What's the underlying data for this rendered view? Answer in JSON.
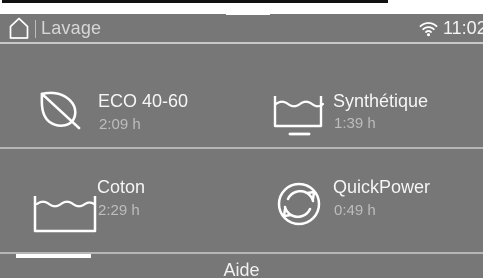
{
  "status_bar": {
    "title": "Lavage",
    "time": "11:02",
    "home_icon": "home-icon",
    "wifi_icon": "wifi-icon"
  },
  "programs": [
    {
      "name": "ECO 40-60",
      "duration": "2:09 h",
      "icon": "leaf-icon"
    },
    {
      "name": "Synthétique",
      "duration": "1:39 h",
      "icon": "synthetic-wash-tub-icon"
    },
    {
      "name": "Coton",
      "duration": "2:29 h",
      "icon": "cotton-wash-tub-icon"
    },
    {
      "name": "QuickPower",
      "duration": "0:49 h",
      "icon": "quickpower-cycle-icon"
    }
  ],
  "footer": {
    "help_label": "Aide"
  },
  "colors": {
    "background": "#777777",
    "primary_text": "#f6f6f6",
    "secondary_text": "#bdbdbd",
    "divider": "#b6b6b6",
    "active_indicator": "#ffffff"
  }
}
